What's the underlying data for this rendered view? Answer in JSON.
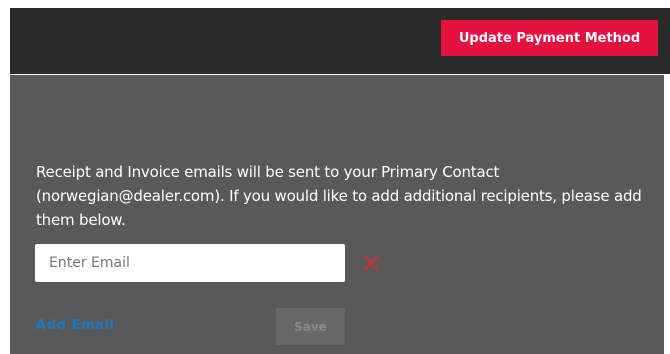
{
  "header": {
    "update_payment_label": "Update Payment Method"
  },
  "colors": {
    "accent": "#e3123e",
    "link": "#1e78c8",
    "panel_bg": "#595959",
    "topbar_bg": "#2a2a2a",
    "remove_icon": "#e0282e"
  },
  "recipients": {
    "notice_text": "Receipt and Invoice emails will be sent to your Primary Contact (norwegian@dealer.com). If you would like to add additional recipients, please add them below.",
    "email_input": {
      "placeholder": "Enter Email",
      "value": ""
    },
    "remove_icon": "close-x-icon",
    "add_email_label": "Add Email",
    "save_label": "Save"
  }
}
